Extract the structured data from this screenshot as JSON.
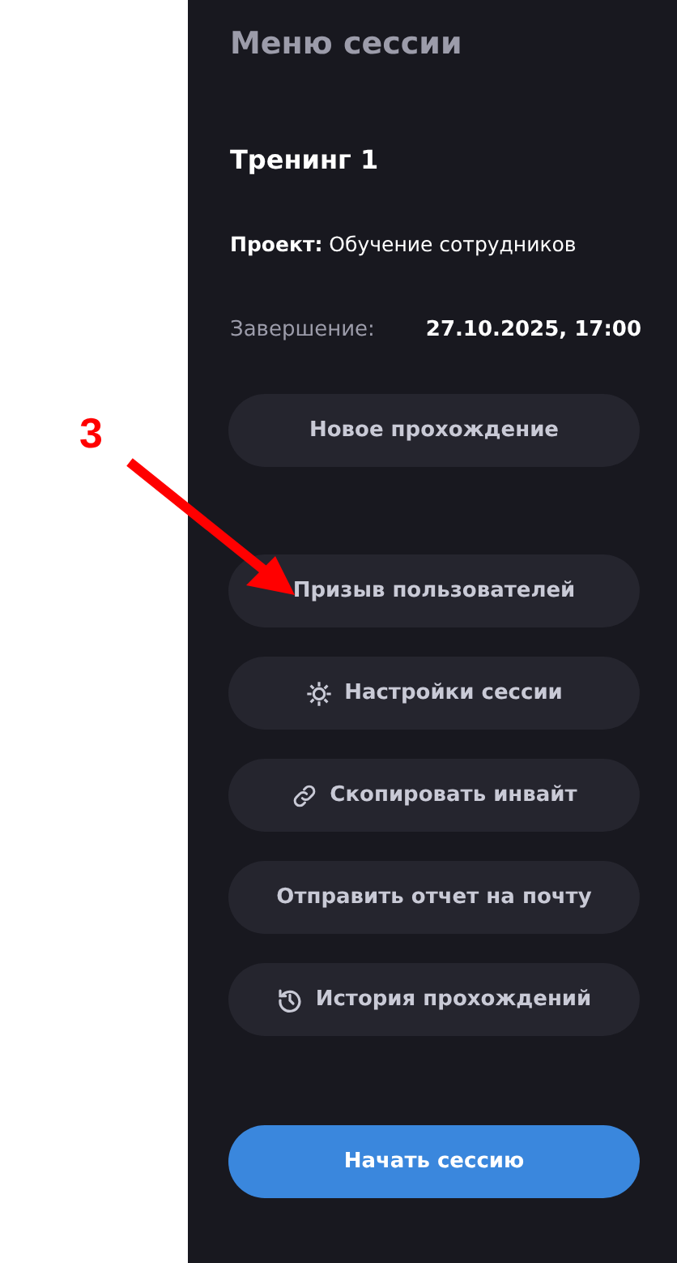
{
  "annotation": {
    "label": "3"
  },
  "panel": {
    "title": "Меню сессии",
    "session_name": "Тренинг 1",
    "project": "**Проект:** Обучение сотрудников",
    "end_label": "Завершение:",
    "end_value": "27.10.2025, 17:00"
  },
  "buttons": [
    {
      "label": "Новое прохождение",
      "kind": "plain"
    },
    {
      "label": "Призыв пользователей",
      "kind": "plain"
    },
    {
      "label": "Настройки сессии",
      "kind": "gear"
    },
    {
      "label": "Скопировать инвайт",
      "kind": "link"
    },
    {
      "label": "Отправить отчет на почту",
      "kind": "plain"
    },
    {
      "label": "История прохождений",
      "kind": "history"
    }
  ],
  "primary_button": {
    "label": "Начать сессию"
  }
}
